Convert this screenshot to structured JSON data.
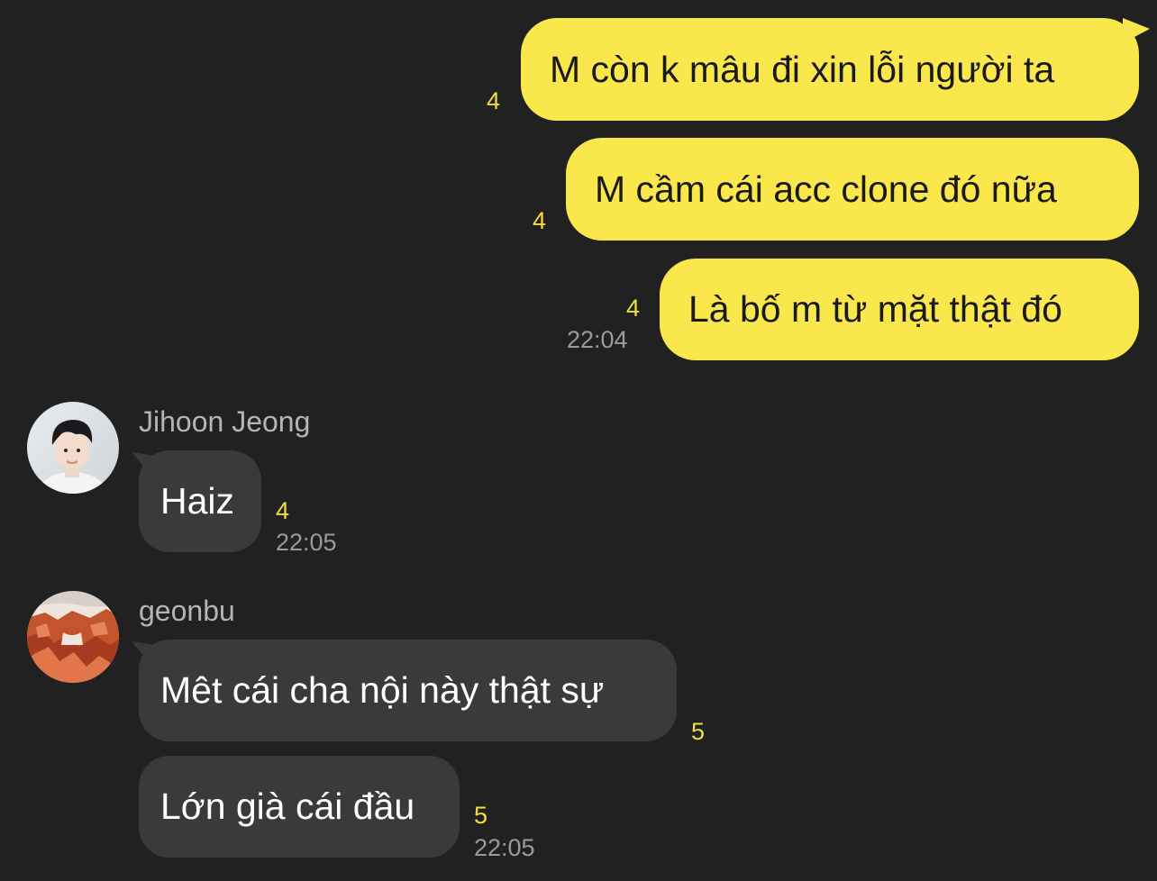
{
  "chat": {
    "outgoing": [
      {
        "text": "M còn k mâu đi xin lỗi người ta",
        "unread": "4"
      },
      {
        "text": "M cầm cái acc clone đó nữa",
        "unread": "4"
      },
      {
        "text": "Là bố m từ mặt thật đó",
        "unread": "4",
        "time": "22:04"
      }
    ],
    "incoming": [
      {
        "sender": "Jihoon Jeong",
        "avatar": "person-avatar-icon",
        "messages": [
          {
            "text": "Haiz",
            "unread": "4",
            "time": "22:05"
          }
        ]
      },
      {
        "sender": "geonbu",
        "avatar": "red-rock-landscape-avatar-icon",
        "messages": [
          {
            "text": "Mêt cái cha nội này thật sự",
            "unread": "5"
          },
          {
            "text": "Lớn già cái đầu",
            "unread": "5",
            "time": "22:05"
          }
        ]
      }
    ]
  },
  "colors": {
    "background": "#212121",
    "outgoing_bubble": "#fae74b",
    "incoming_bubble": "#3a3a3a",
    "unread_count": "#f3dd3c",
    "timestamp": "#9a9a9a",
    "sender_name": "#b5b5b5"
  }
}
